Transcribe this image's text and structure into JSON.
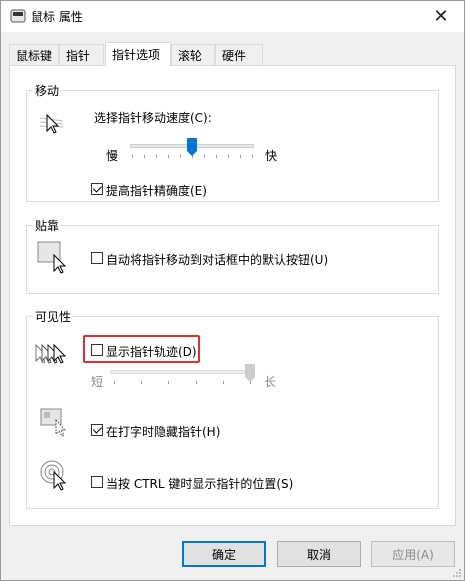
{
  "window": {
    "title": "鼠标 属性",
    "close_glyph": "✕"
  },
  "tabs": [
    {
      "label": "鼠标键"
    },
    {
      "label": "指针"
    },
    {
      "label": "指针选项",
      "active": true
    },
    {
      "label": "滚轮"
    },
    {
      "label": "硬件"
    }
  ],
  "motion": {
    "group_label": "移动",
    "speed_label": "选择指针移动速度(C):",
    "slow_label": "慢",
    "fast_label": "快",
    "speed_level_fraction": 0.5,
    "precision_label": "提高指针精确度(E)",
    "precision_checked": true
  },
  "snap": {
    "group_label": "贴靠",
    "snap_label": "自动将指针移动到对话框中的默认按钮(U)",
    "snap_checked": false
  },
  "visibility": {
    "group_label": "可见性",
    "trails_label": "显示指针轨迹(D)",
    "trails_checked": false,
    "short_label": "短",
    "long_label": "长",
    "trail_length_fraction": 1.0,
    "hide_typing_label": "在打字时隐藏指针(H)",
    "hide_typing_checked": true,
    "ctrl_show_label": "当按 CTRL 键时显示指针的位置(S)",
    "ctrl_show_checked": false
  },
  "buttons": {
    "ok": "确定",
    "cancel": "取消",
    "apply": "应用(A)"
  },
  "colors": {
    "accent": "#0078d7",
    "highlight": "#e0302a"
  }
}
